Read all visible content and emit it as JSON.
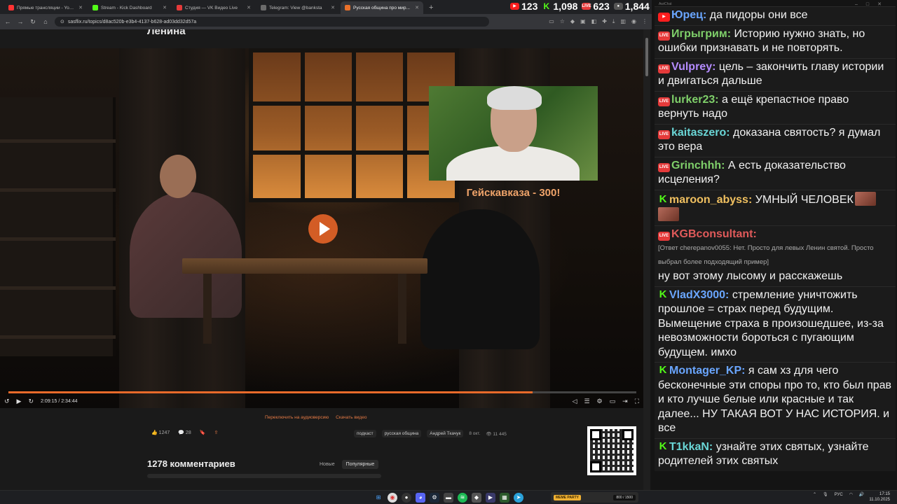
{
  "browser": {
    "tabs": [
      {
        "label": "Прямые трансляции - YouTube",
        "color": "#ff3333"
      },
      {
        "label": "Stream - Kick Dashboard",
        "color": "#53fc18"
      },
      {
        "label": "Студия — VK Видео Live",
        "color": "#e53a3a"
      },
      {
        "label": "Telegram: View @banksta",
        "color": "#6b6b6b"
      },
      {
        "label": "Русская община про мир...",
        "color": "#e8702a",
        "active": true
      }
    ],
    "url": "sasflix.ru/topics/d8ac520b-e3b4-4137-b628-ad03dd32d57a"
  },
  "counters": {
    "youtube": "123",
    "kick": "1,098",
    "vk": "623",
    "total": "1,844"
  },
  "page": {
    "title_fragment": "Ленина",
    "video_caption": "Гейскавказа - 300!",
    "time_current": "2:09:15",
    "time_total": "2:34:44",
    "progress": 0.835,
    "audio_link": "Переключить на аудиоверсию",
    "download_link": "Скачать видео",
    "likes": "1247",
    "comments_count": "28",
    "tags": [
      "подкаст",
      "русская община",
      "Андрей Ткачук"
    ],
    "date": "8 окт.",
    "views": "11 445",
    "comments_title": "1278 комментариев",
    "sort_new": "Новые",
    "sort_popular": "Популярные"
  },
  "chat": {
    "header": "AwiChat",
    "messages": [
      {
        "platform": "yt",
        "nick": "Юрец:",
        "color": "#6aa6ff",
        "text": "да пидоры они все"
      },
      {
        "platform": "vk",
        "nick": "Игрыгрим:",
        "color": "#7fd06a",
        "text": "Историю нужно знать, но ошибки признавать и не повторять."
      },
      {
        "platform": "vk",
        "nick": "Vulprey:",
        "color": "#b58cff",
        "text": "цель – закончить главу истории и двигаться дальше"
      },
      {
        "platform": "vk",
        "nick": "lurker23:",
        "color": "#7fd06a",
        "text": "а ещё крепастное право вернуть надо"
      },
      {
        "platform": "vk",
        "nick": "kaitaszero:",
        "color": "#6ad6d6",
        "text": "доказана святость? я думал это вера"
      },
      {
        "platform": "vk",
        "nick": "Grinchhh:",
        "color": "#7fd06a",
        "text": "А есть доказательство исцеления?"
      },
      {
        "platform": "kick",
        "nick": "maroon_abyss:",
        "color": "#f0c060",
        "text": "УМНЫЙ ЧЕЛОВЕК",
        "emotes": true
      },
      {
        "platform": "vk",
        "nick": "KGBconsultant:",
        "color": "#e05a5a",
        "reply": "[Ответ cherepanov0055: Нет. Просто для левых Ленин святой. Просто выбрал более подходящий пример]",
        "text": "ну вот этому лысому и расскажешь"
      },
      {
        "platform": "kick",
        "nick": "VladX3000:",
        "color": "#6aa6ff",
        "text": "стремление уничтожить прошлое = страх перед будущим. Вымещение страха в произошедшее, из-за невозможности бороться с пугающим будущем. имхо"
      },
      {
        "platform": "kick",
        "nick": "Montager_KP:",
        "color": "#6aa6ff",
        "text": "я сам хз для чего бесконечные эти споры про то, кто был прав и кто лучше белые или красные и так далее... НУ ТАКАЯ ВОТ У НАС ИСТОРИЯ. и все"
      },
      {
        "platform": "kick",
        "nick": "T1kkaN:",
        "color": "#6ad6d6",
        "text": "узнайте этих святых, узнайте родителей этих святых"
      }
    ]
  },
  "taskbar": {
    "meme_label": "MEME PARTY",
    "meme_progress": "800 / 1500",
    "lang": "РУС",
    "time": "17:15",
    "date": "11.10.2025"
  },
  "icons": {
    "back": "←",
    "forward": "→",
    "reload": "↻",
    "home": "⌂",
    "play": "▶",
    "rewind": "↺",
    "forward10": "↻",
    "volume": "◁",
    "settings": "⚙",
    "fullscreen": "⛶",
    "like": "👍",
    "comment": "💬"
  }
}
